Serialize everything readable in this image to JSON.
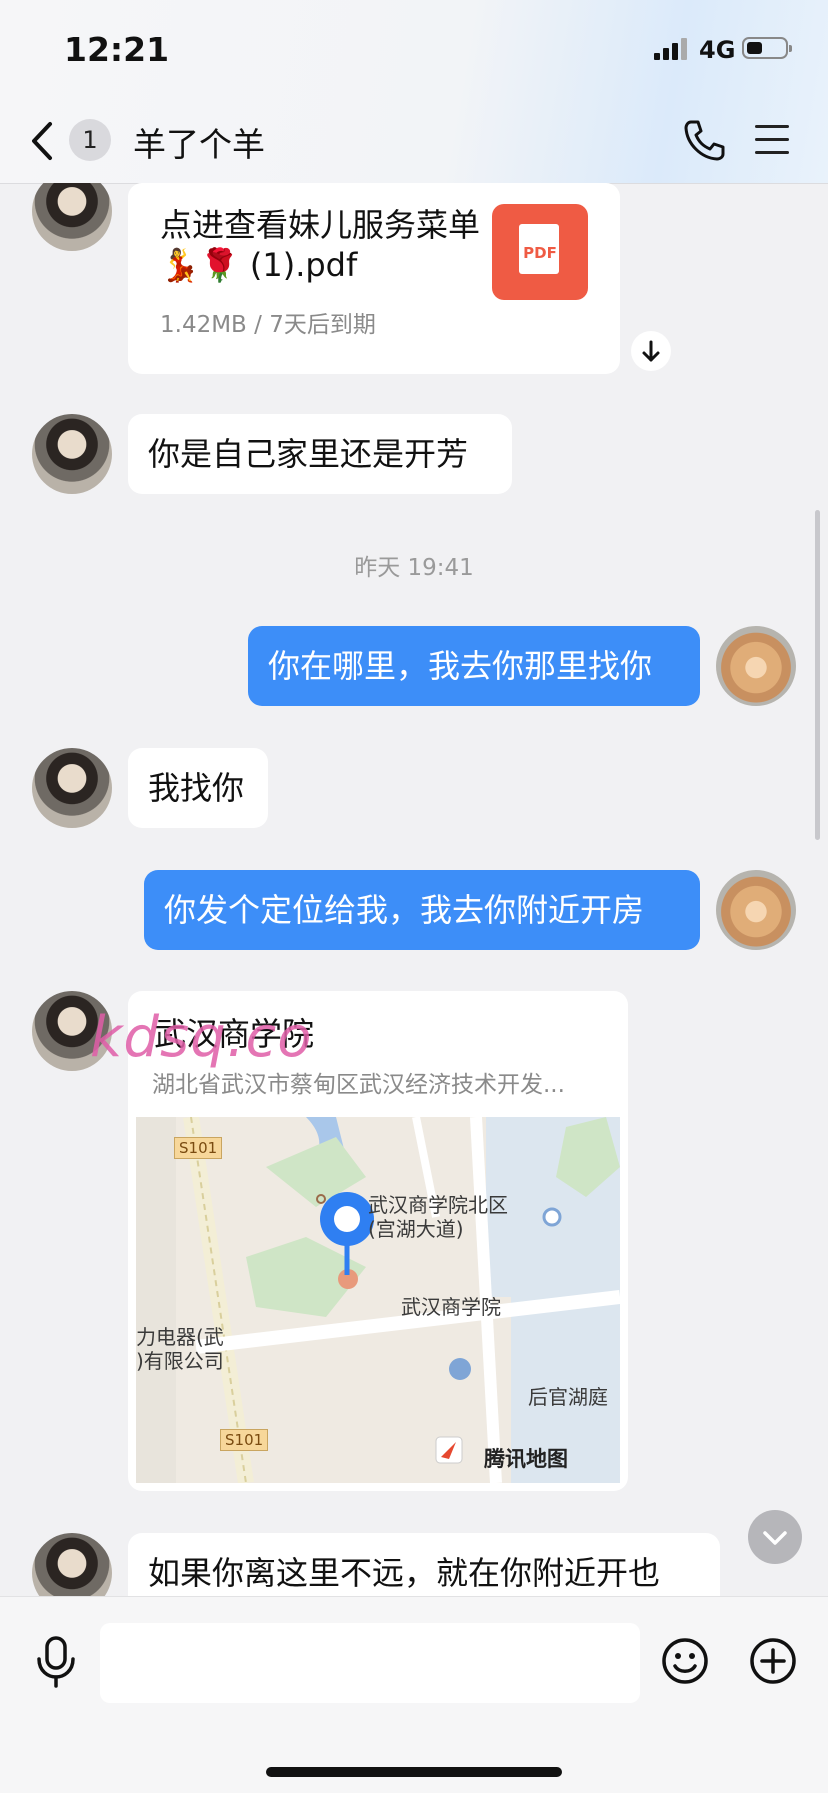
{
  "status_bar": {
    "time": "12:21",
    "network": "4G"
  },
  "header": {
    "unread_count": "1",
    "title": "羊了个羊"
  },
  "messages": {
    "file": {
      "name": "点进查看妹儿服务菜单💃🌹 (1).pdf",
      "meta": "1.42MB / 7天后到期",
      "icon_label": "PDF"
    },
    "m1": "你是自己家里还是开芳",
    "timestamp": "昨天 19:41",
    "m2": "你在哪里，我去你那里找你",
    "m3": "我找你",
    "m4": "你发个定位给我，我去你附近开房",
    "location": {
      "name": "武汉商学院",
      "address": "湖北省武汉市蔡甸区武汉经济技术开发...",
      "map_labels": {
        "road1": "S101",
        "road2": "S101",
        "north": "武汉商学院北区",
        "north_sub": "(宫湖大道)",
        "school": "武汉商学院",
        "company1": "力电器(武",
        "company2": ")有限公司",
        "lake": "后官湖庭",
        "brand": "腾讯地图"
      }
    },
    "m5": "如果你离这里不远，就在你附近开也"
  },
  "watermark": "kdsq.co",
  "input": {
    "placeholder": ""
  },
  "colors": {
    "accent": "#3d8ef8",
    "pdf": "#ef5b44",
    "watermark": "#e05ea8"
  }
}
